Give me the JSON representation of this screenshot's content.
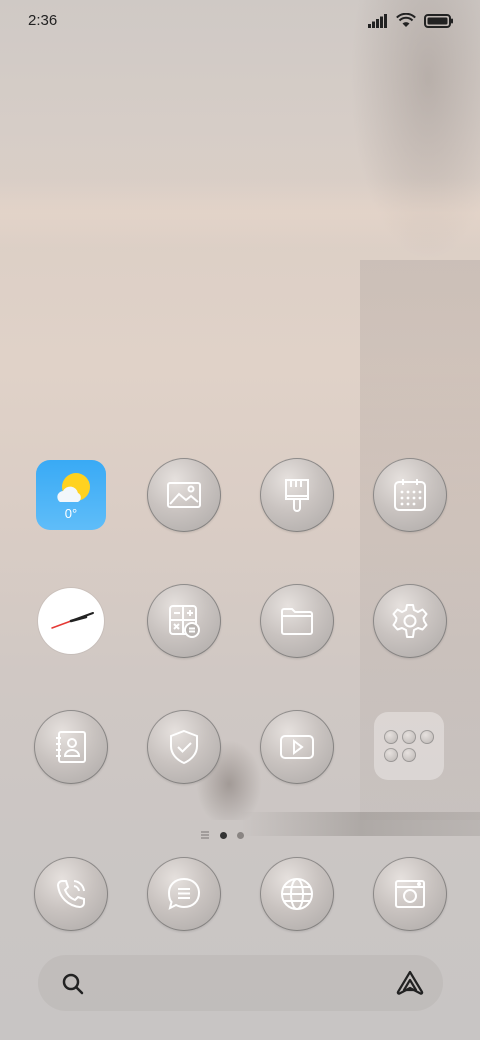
{
  "status_bar": {
    "time": "2:36"
  },
  "weather_widget": {
    "temperature": "0°"
  },
  "page_indicator": {
    "pages": 2,
    "active_index": 1
  },
  "apps_row1": [
    {
      "name": "weather",
      "icon": "weather-icon"
    },
    {
      "name": "gallery",
      "icon": "image-icon"
    },
    {
      "name": "themes",
      "icon": "paintbrush-icon"
    },
    {
      "name": "calendar",
      "icon": "calendar-icon"
    }
  ],
  "apps_row2": [
    {
      "name": "clock",
      "icon": "clock-icon"
    },
    {
      "name": "calculator",
      "icon": "calculator-icon"
    },
    {
      "name": "files",
      "icon": "folder-icon"
    },
    {
      "name": "settings",
      "icon": "gear-icon"
    }
  ],
  "apps_row3": [
    {
      "name": "contacts",
      "icon": "contacts-icon"
    },
    {
      "name": "security",
      "icon": "shield-icon"
    },
    {
      "name": "video",
      "icon": "play-icon"
    },
    {
      "name": "app-folder",
      "icon": "folder-grid-icon"
    }
  ],
  "dock": [
    {
      "name": "phone",
      "icon": "phone-icon"
    },
    {
      "name": "messages",
      "icon": "chat-icon"
    },
    {
      "name": "browser",
      "icon": "globe-icon"
    },
    {
      "name": "camera",
      "icon": "camera-icon"
    }
  ],
  "search_bar": {
    "icon": "search-icon",
    "assistant_icon": "assistant-icon"
  }
}
